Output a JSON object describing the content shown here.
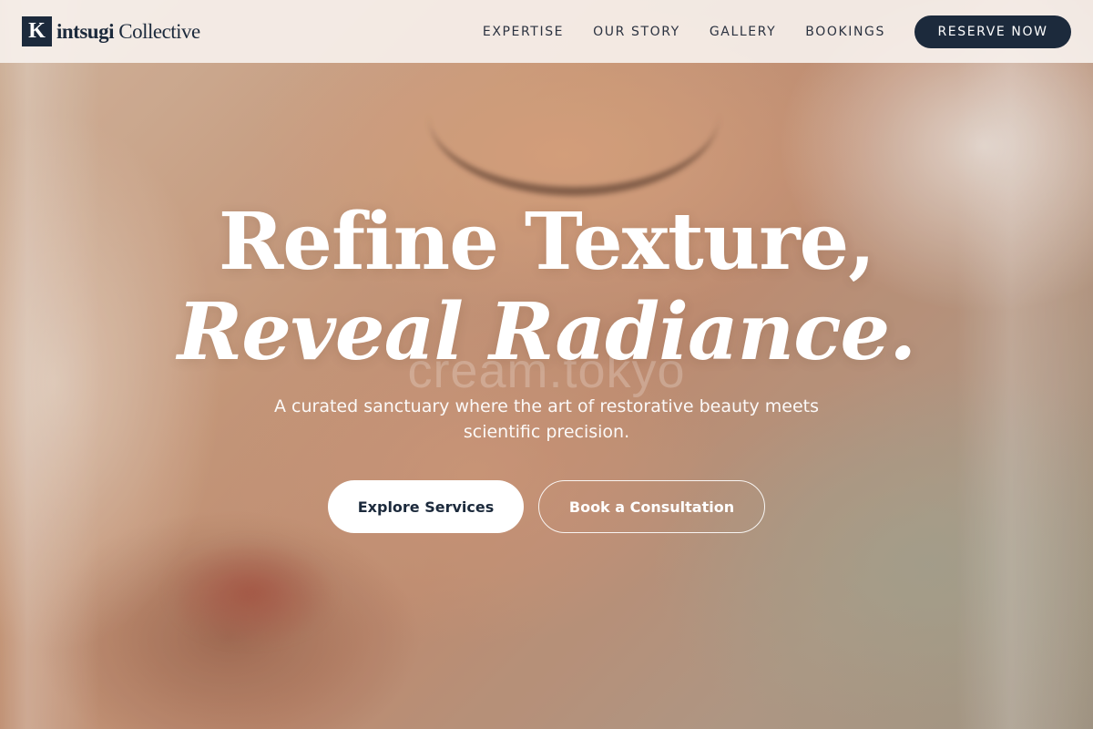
{
  "brand": {
    "mark": "K",
    "name_bold": "intsugi",
    "name_rest": "Collective"
  },
  "nav": {
    "links": [
      {
        "label": "EXPERTISE"
      },
      {
        "label": "OUR STORY"
      },
      {
        "label": "GALLERY"
      },
      {
        "label": "BOOKINGS"
      }
    ],
    "cta_label": "RESERVE NOW"
  },
  "hero": {
    "headline_line1": "Refine Texture,",
    "headline_line2": "Reveal Radiance.",
    "subtext": "A curated sanctuary where the art of restorative beauty meets scientific precision.",
    "primary_cta": "Explore Services",
    "secondary_cta": "Book a Consultation",
    "watermark": "cream.tokyo"
  },
  "colors": {
    "brand_navy": "#1c2a3c",
    "header_bg": "#f6f0ec",
    "text_light": "#ffffff"
  }
}
